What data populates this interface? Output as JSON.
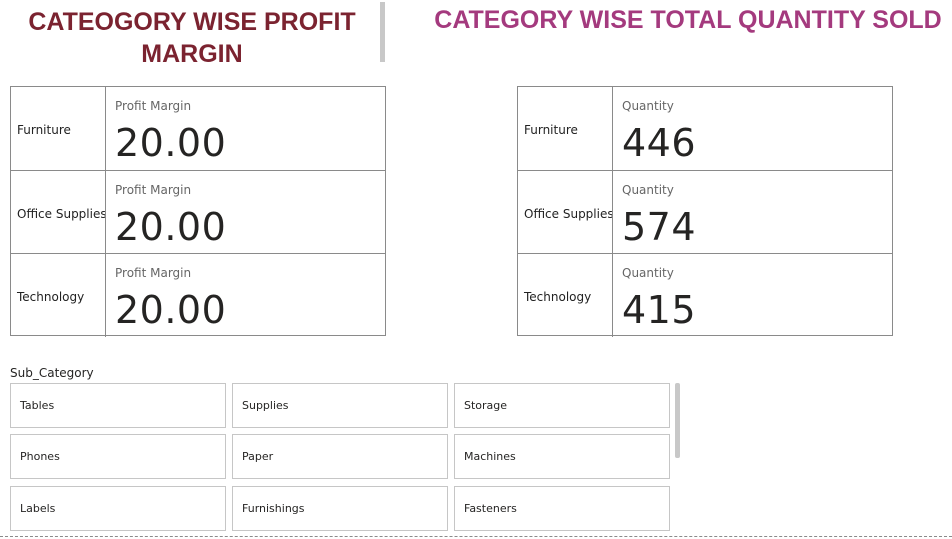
{
  "titles": {
    "left_line1": "CATEOGORY WISE  PROFIT",
    "left_line2": "MARGIN",
    "right": "CATEGORY WISE TOTAL QUANTITY SOLD"
  },
  "profit_card": {
    "rows": [
      {
        "category": "Furniture",
        "label": "Profit Margin",
        "value": "20.00"
      },
      {
        "category": "Office Supplies",
        "label": "Profit Margin",
        "value": "20.00"
      },
      {
        "category": "Technology",
        "label": "Profit Margin",
        "value": "20.00"
      }
    ]
  },
  "quantity_card": {
    "rows": [
      {
        "category": "Furniture",
        "label": "Quantity",
        "value": "446"
      },
      {
        "category": "Office Supplies",
        "label": "Quantity",
        "value": "574"
      },
      {
        "category": "Technology",
        "label": "Quantity",
        "value": "415"
      }
    ]
  },
  "slicer": {
    "title": "Sub_Category",
    "items": [
      "Tables",
      "Supplies",
      "Storage",
      "Phones",
      "Paper",
      "Machines",
      "Labels",
      "Furnishings",
      "Fasteners"
    ]
  },
  "colors": {
    "left_title": "#7b2330",
    "right_title": "#a43a7e",
    "border": "#8a8a8a"
  }
}
